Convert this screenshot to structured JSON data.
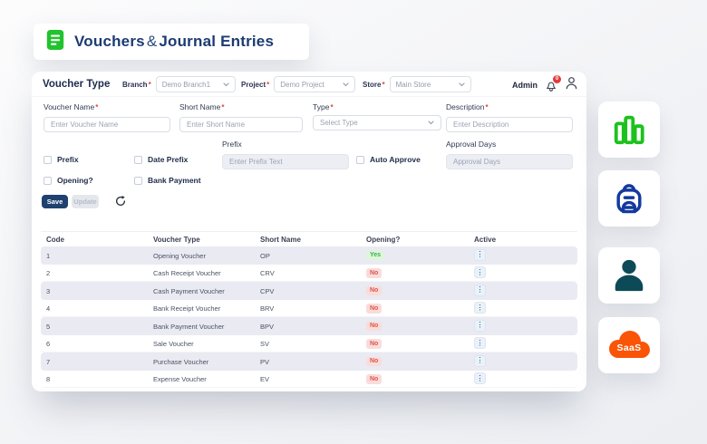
{
  "header": {
    "title_part1": "Vouchers",
    "title_amp": "&",
    "title_part2": "Journal Entries"
  },
  "topbar": {
    "panel_title": "Voucher Type",
    "filters": [
      {
        "label": "Branch",
        "required": "*",
        "value": "Demo Branch1"
      },
      {
        "label": "Project",
        "required": "*",
        "value": "Demo Project"
      },
      {
        "label": "Store",
        "required": "*",
        "value": "Main Store"
      }
    ],
    "admin_label": "Admin",
    "notification_count": "0"
  },
  "form": {
    "fields": {
      "voucher_name": {
        "label": "Voucher Name",
        "required": "*",
        "placeholder": "Enter Voucher Name"
      },
      "short_name": {
        "label": "Short Name",
        "required": "*",
        "placeholder": "Enter Short Name"
      },
      "type": {
        "label": "Type",
        "required": "*",
        "placeholder": "Select Type"
      },
      "description": {
        "label": "Description",
        "required": "*",
        "placeholder": "Enter Description"
      },
      "prefix_text": {
        "label": "Prefix",
        "placeholder": "Enter Prefix Text"
      },
      "approval_days": {
        "label": "Approval Days",
        "placeholder": "Approval Days"
      }
    },
    "checkboxes": {
      "prefix": "Prefix",
      "date_prefix": "Date Prefix",
      "auto_approve": "Auto Approve",
      "opening": "Opening?",
      "bank_payment": "Bank Payment"
    },
    "buttons": {
      "save": "Save",
      "update": "Update"
    }
  },
  "table": {
    "headers": [
      "Code",
      "Voucher Type",
      "Short Name",
      "Opening?",
      "Active"
    ],
    "action_glyph": "⋮",
    "rows": [
      {
        "code": "1",
        "type": "Opening Voucher",
        "short": "OP",
        "opening": "Yes"
      },
      {
        "code": "2",
        "type": "Cash Receipt Voucher",
        "short": "CRV",
        "opening": "No"
      },
      {
        "code": "3",
        "type": "Cash Payment Voucher",
        "short": "CPV",
        "opening": "No"
      },
      {
        "code": "4",
        "type": "Bank Receipt Voucher",
        "short": "BRV",
        "opening": "No"
      },
      {
        "code": "5",
        "type": "Bank Payment Voucher",
        "short": "BPV",
        "opening": "No"
      },
      {
        "code": "6",
        "type": "Sale Voucher",
        "short": "SV",
        "opening": "No"
      },
      {
        "code": "7",
        "type": "Purchase Voucher",
        "short": "PV",
        "opening": "No"
      },
      {
        "code": "8",
        "type": "Expense Voucher",
        "short": "EV",
        "opening": "No"
      }
    ]
  },
  "side_icons": [
    {
      "name": "bar-chart"
    },
    {
      "name": "backpack"
    },
    {
      "name": "user"
    },
    {
      "name": "saas-cloud",
      "label": "SaaS"
    }
  ],
  "colors": {
    "brand_navy": "#1c3b72",
    "brand_green": "#22c32d",
    "save_navy": "#1e416f",
    "saas_orange": "#fa5407",
    "backpack_blue": "#143a9e",
    "person_teal": "#0d4a57",
    "required_red": "#d94a43",
    "badge_yes_bg": "#ddf6da",
    "badge_yes_text": "#3fae4a",
    "badge_no_bg": "#fadcda",
    "badge_no_text": "#dd564c",
    "row_stripe": "#e9eaf2",
    "notification_red": "#e23b3b"
  }
}
